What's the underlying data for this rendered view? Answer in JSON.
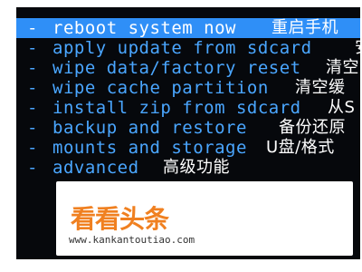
{
  "recovery_menu": {
    "items": [
      {
        "label": "reboot system now",
        "label_zh": "重启手机",
        "selected": true
      },
      {
        "label": "apply update from sdcard",
        "label_zh": "安",
        "selected": false
      },
      {
        "label": "wipe data/factory reset",
        "label_zh": "清空",
        "selected": false
      },
      {
        "label": "wipe cache partition",
        "label_zh": "清空缓",
        "selected": false
      },
      {
        "label": "install zip from sdcard",
        "label_zh": "从S",
        "selected": false
      },
      {
        "label": "backup and restore",
        "label_zh": "备份还原",
        "selected": false
      },
      {
        "label": "mounts and storage",
        "label_zh": "U盘/格式",
        "selected": false
      },
      {
        "label": "advanced",
        "label_zh": "高级功能",
        "selected": false
      }
    ],
    "bullet": "-"
  },
  "watermark": {
    "logo_text": "看看头条",
    "url": "www.kankantoutiao.com"
  },
  "colors": {
    "screen_bg": "#06080c",
    "item_text": "#4aa6ff",
    "selected_bg": "#2f8ff7",
    "selected_text": "#ffffff",
    "watermark_orange": "#f08020"
  }
}
